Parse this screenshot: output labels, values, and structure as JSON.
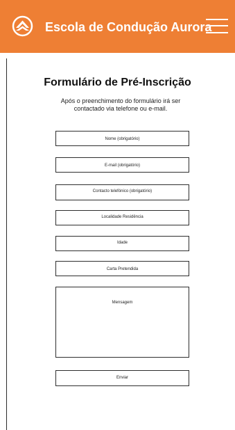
{
  "header": {
    "title": "Escola de Condução Aurora",
    "logo_icon": "aurora-logo-icon",
    "menu_icon": "hamburger-menu-icon",
    "accent_color": "#ee7f34"
  },
  "form": {
    "title": "Formulário de Pré-Inscrição",
    "intro": "Após o preenchimento do formulário irá ser contactado via telefone ou e-mail.",
    "fields": {
      "name_placeholder": "Nome (obrigatório)",
      "email_placeholder": "E-mail (obrigatório)",
      "phone_placeholder": "Contacto telefónico (obrigatório)",
      "residence_placeholder": "Localidade Residência",
      "age_placeholder": "Idade",
      "licence_placeholder": "Carta Pretendida",
      "message_placeholder": "Mensagem"
    },
    "submit_label": "Enviar"
  }
}
